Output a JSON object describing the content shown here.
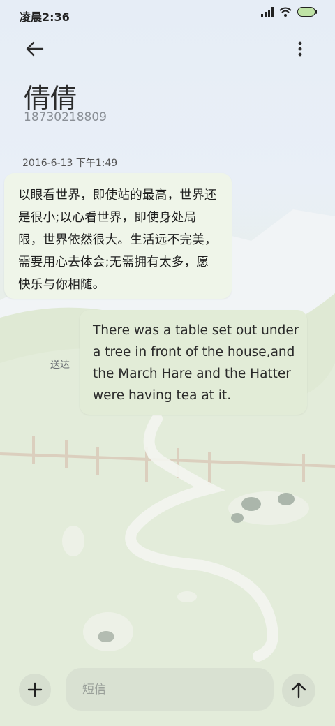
{
  "status_bar": {
    "time": "凌晨2:36",
    "icons": [
      "signal-icon",
      "wifi-icon",
      "battery-icon"
    ]
  },
  "header": {
    "back_icon": "back-arrow-icon",
    "more_icon": "more-vertical-icon",
    "contact_name": "倩倩",
    "contact_number": "18730218809"
  },
  "conversation": {
    "timestamp": "2016-6-13 下午1:49",
    "messages": [
      {
        "direction": "incoming",
        "text": "以眼看世界，即使站的最高，世界还是很小;以心看世界，即使身处局限，世界依然很大。生活远不完美，需要用心去体会;无需拥有太多，愿快乐与你相随。"
      },
      {
        "direction": "outgoing",
        "text": "There was a table set out under a tree in front of the house,and the March Hare and the Hatter were having tea at it.",
        "status": "送达"
      }
    ]
  },
  "composer": {
    "add_icon": "plus-icon",
    "placeholder": "短信",
    "send_icon": "arrow-up-icon"
  },
  "colors": {
    "incoming_bubble": "#eff5e9",
    "outgoing_bubble": "#e2ecd7",
    "input_background": "#d9e1d2"
  }
}
